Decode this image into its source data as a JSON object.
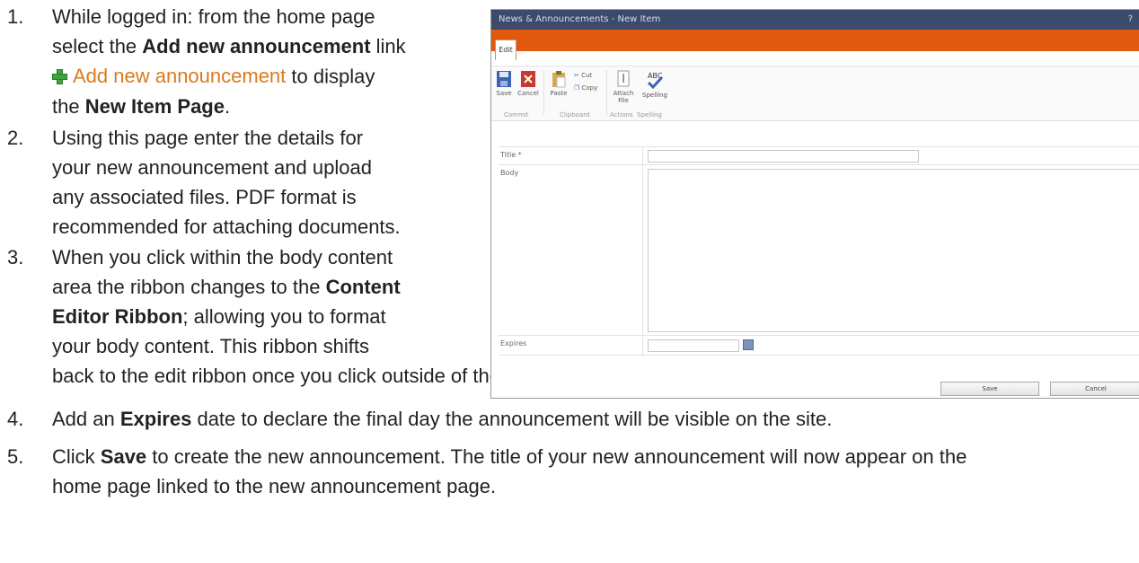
{
  "steps": [
    {
      "num": "1.",
      "l1": "While logged in: from the home page",
      "l2a": "select the ",
      "l2b": "Add new announcement",
      "l2c": " link",
      "link": "Add new announcement",
      "l3": " to display",
      "l4a": "the ",
      "l4b": "New Item Page",
      "l4c": "."
    },
    {
      "num": "2.",
      "l1": "Using this page enter the details for",
      "l2": "your new announcement and upload",
      "l3": "any associated files. PDF format is",
      "l4": "recommended for attaching documents."
    },
    {
      "num": "3.",
      "l1": "When you click within the body content",
      "l2a": "area the ribbon changes to the ",
      "l2b": "Content",
      "l3a": "Editor Ribbon",
      "l3b": "; allowing you to format",
      "l4": "your body content.  This ribbon shifts",
      "l5": "back to the edit ribbon once you click outside of the Body area."
    },
    {
      "num": "4.",
      "a": "Add an ",
      "b": "Expires",
      "c": " date to declare the final day the announcement will be visible on the site."
    },
    {
      "num": "5.",
      "a": "Click ",
      "b": "Save",
      "c": " to create the new announcement. The title of your new announcement will now appear on the",
      "d": "home page linked to the new announcement page."
    }
  ],
  "screenshot": {
    "title": "News & Announcements - New Item",
    "help": "?",
    "tab": "Edit",
    "ribbon": {
      "save": "Save",
      "cancel": "Cancel",
      "paste": "Paste",
      "cut": "Cut",
      "copy": "Copy",
      "attach": "Attach File",
      "spelling": "Spelling",
      "groups": [
        "Commit",
        "Clipboard",
        "Actions",
        "Spelling"
      ]
    },
    "fields": {
      "title": "Title *",
      "body": "Body",
      "expires": "Expires"
    },
    "buttons": {
      "save": "Save",
      "cancel": "Cancel"
    },
    "colors": {
      "titlebar": "#3c4a6b",
      "ribbon_band": "#e0590e",
      "link": "#d97a1e"
    }
  }
}
